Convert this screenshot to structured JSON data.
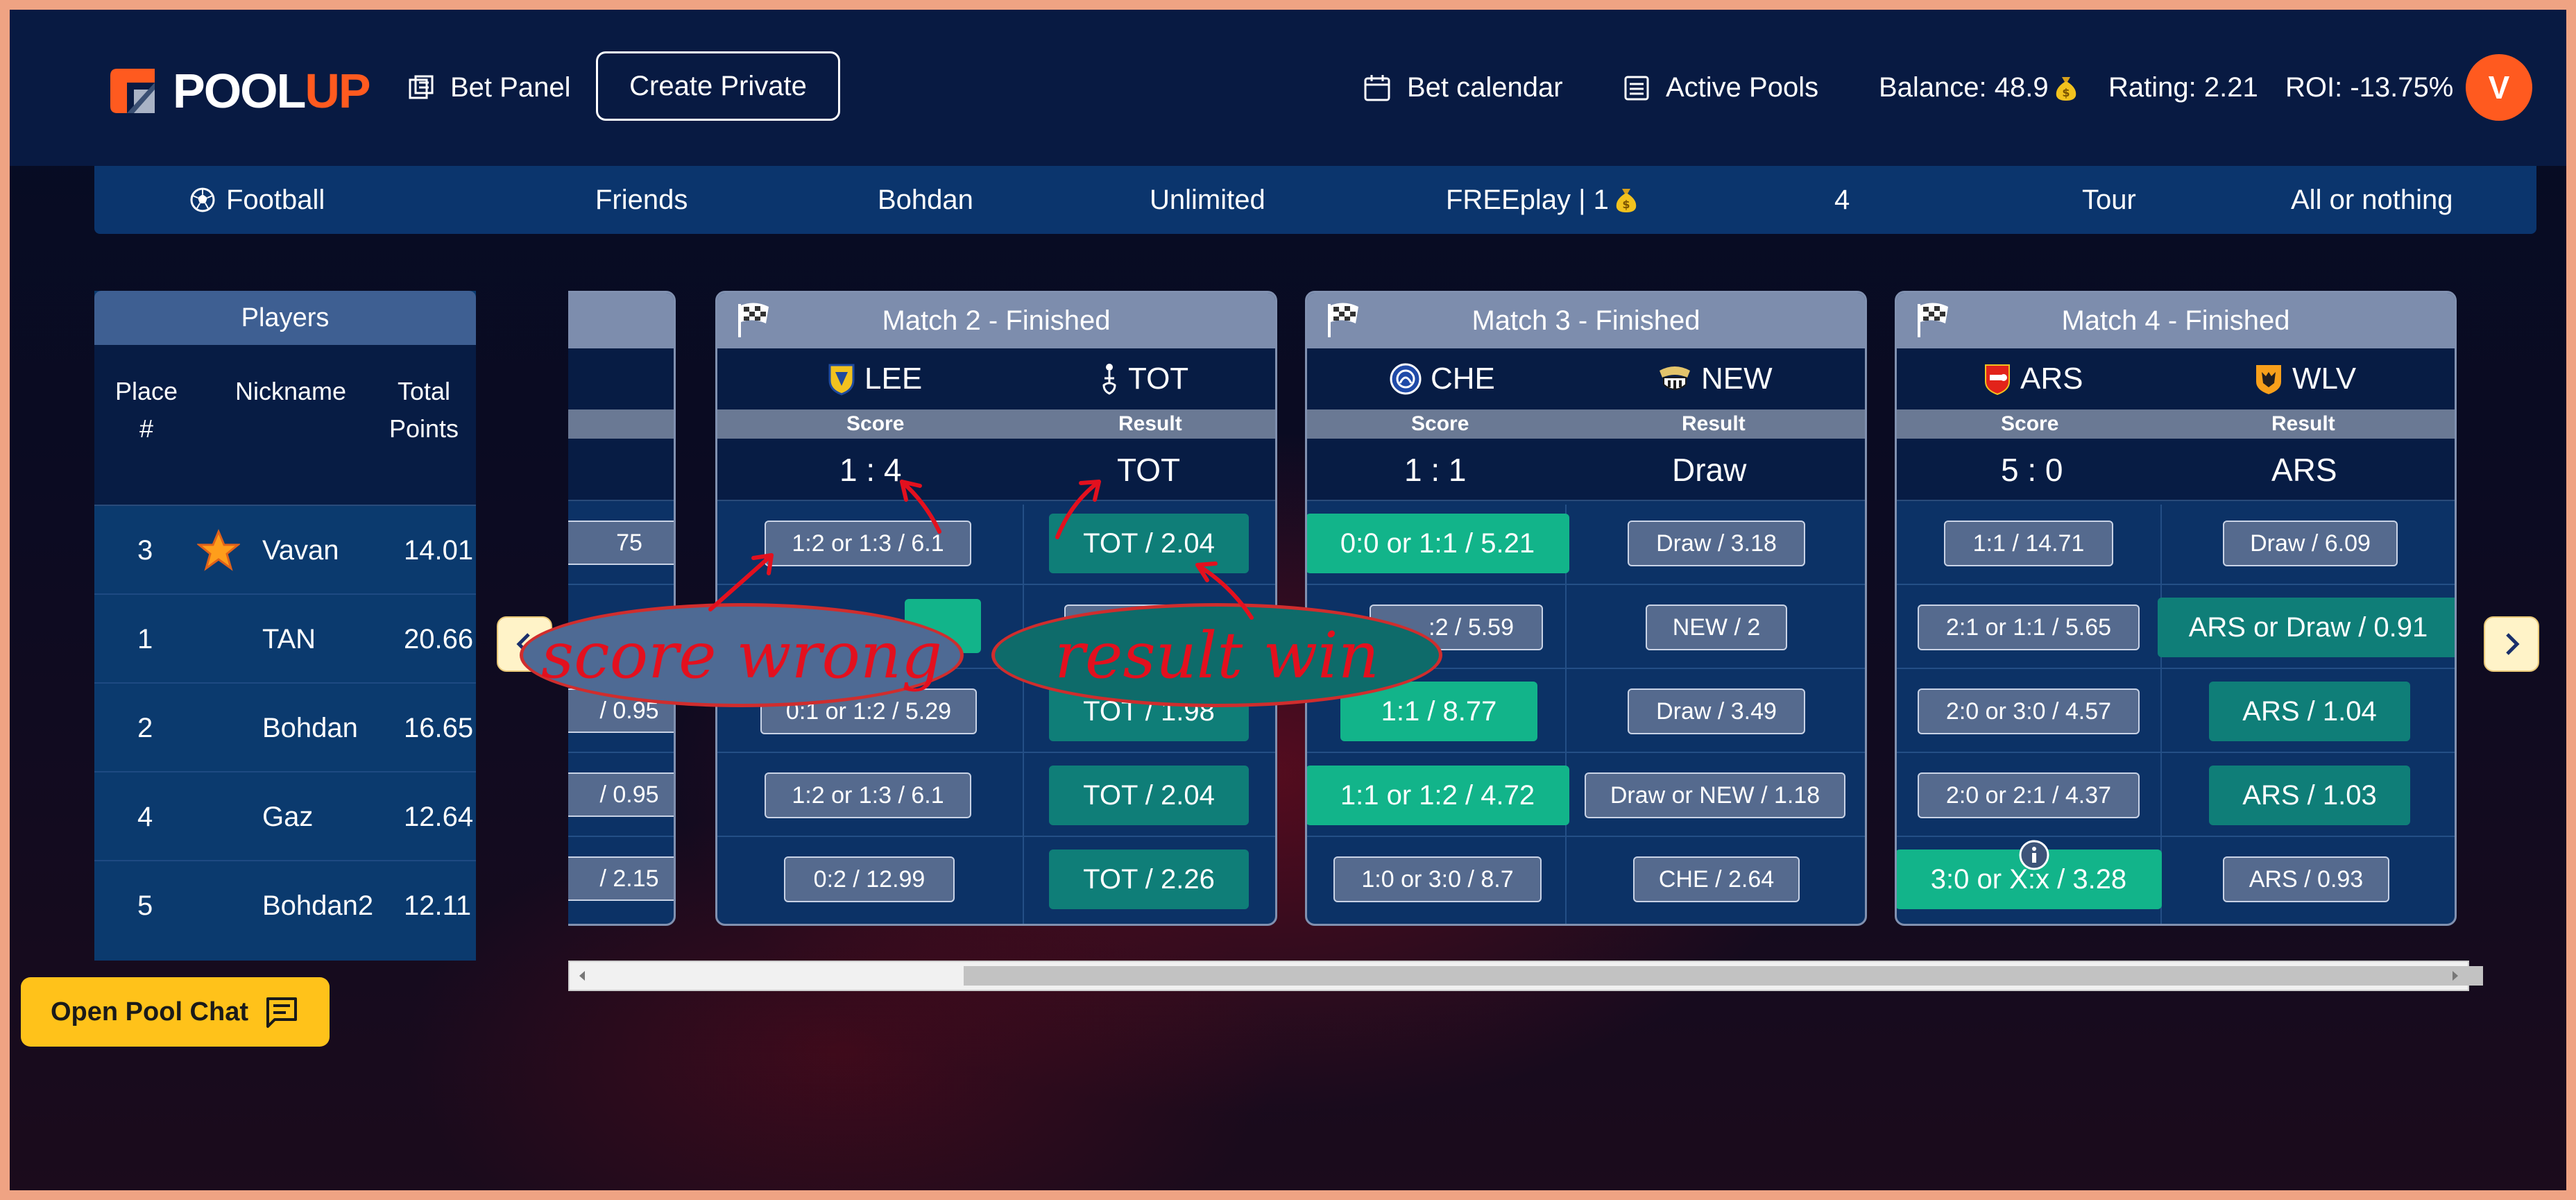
{
  "header": {
    "logo": {
      "part1": "POOL",
      "part2": "UP"
    },
    "nav": {
      "bet_panel": "Bet Panel",
      "create_private": "Create Private",
      "bet_calendar": "Bet calendar",
      "active_pools": "Active Pools"
    },
    "balance": "Balance: 48.9",
    "rating": "Rating: 2.21",
    "roi": "ROI: -13.75%",
    "avatar": "V"
  },
  "filters": [
    "Football",
    "Friends",
    "Bohdan",
    "Unlimited",
    "FREEplay | 1",
    "4",
    "Tour",
    "All or nothing"
  ],
  "players": {
    "title": "Players",
    "columns": {
      "place": "Place\n#",
      "nickname": "Nickname",
      "points": "Total\nPoints"
    },
    "rows": [
      {
        "place": "3",
        "nickname": "Vavan",
        "points": "14.01",
        "star": true
      },
      {
        "place": "1",
        "nickname": "TAN",
        "points": "20.66"
      },
      {
        "place": "2",
        "nickname": "Bohdan",
        "points": "16.65"
      },
      {
        "place": "4",
        "nickname": "Gaz",
        "points": "12.64"
      },
      {
        "place": "5",
        "nickname": "Bohdan2",
        "points": "12.11"
      }
    ]
  },
  "partial_card": {
    "values": [
      "75",
      "",
      "/ 0.95",
      "/ 0.95",
      "/ 2.15"
    ]
  },
  "matches": [
    {
      "title": "Match 2 - Finished",
      "home": "LEE",
      "away": "TOT",
      "score_label": "Score",
      "result_label": "Result",
      "score": "1 : 4",
      "result": "TOT",
      "score_bets": [
        {
          "label": "1:2 or 1:3 / 6.1",
          "style": "grey"
        },
        {
          "label": "",
          "style": "green"
        },
        {
          "label": "0:1 or 1:2 / 5.29",
          "style": "grey"
        },
        {
          "label": "1:2 or 1:3 / 6.1",
          "style": "grey"
        },
        {
          "label": "0:2 / 12.99",
          "style": "grey"
        }
      ],
      "result_bets": [
        {
          "label": "TOT / 2.04",
          "style": "teal"
        },
        {
          "label": "",
          "style": "grey"
        },
        {
          "label": "TOT / 1.98",
          "style": "teal"
        },
        {
          "label": "TOT / 2.04",
          "style": "teal"
        },
        {
          "label": "TOT / 2.26",
          "style": "teal"
        }
      ]
    },
    {
      "title": "Match 3 - Finished",
      "home": "CHE",
      "away": "NEW",
      "score_label": "Score",
      "result_label": "Result",
      "score": "1 : 1",
      "result": "Draw",
      "score_bets": [
        {
          "label": "0:0 or 1:1 / 5.21",
          "style": "green"
        },
        {
          "label": ":2 / 5.59",
          "style": "grey"
        },
        {
          "label": "1:1 / 8.77",
          "style": "green"
        },
        {
          "label": "1:1 or 1:2 / 4.72",
          "style": "green"
        },
        {
          "label": "1:0 or 3:0 / 8.7",
          "style": "grey"
        }
      ],
      "result_bets": [
        {
          "label": "Draw / 3.18",
          "style": "grey"
        },
        {
          "label": "NEW / 2",
          "style": "grey"
        },
        {
          "label": "Draw / 3.49",
          "style": "grey"
        },
        {
          "label": "Draw or NEW / 1.18",
          "style": "grey"
        },
        {
          "label": "CHE / 2.64",
          "style": "grey"
        }
      ]
    },
    {
      "title": "Match 4 - Finished",
      "home": "ARS",
      "away": "WLV",
      "score_label": "Score",
      "result_label": "Result",
      "score": "5 : 0",
      "result": "ARS",
      "score_bets": [
        {
          "label": "1:1 / 14.71",
          "style": "grey"
        },
        {
          "label": "2:1 or 1:1 / 5.65",
          "style": "grey"
        },
        {
          "label": "2:0 or 3:0 / 4.57",
          "style": "grey"
        },
        {
          "label": "2:0 or 2:1 / 4.37",
          "style": "grey"
        },
        {
          "label": "3:0 or X:x / 3.28",
          "style": "green"
        }
      ],
      "result_bets": [
        {
          "label": "Draw / 6.09",
          "style": "grey"
        },
        {
          "label": "ARS or Draw / 0.91",
          "style": "teal"
        },
        {
          "label": "ARS / 1.04",
          "style": "teal"
        },
        {
          "label": "ARS / 1.03",
          "style": "teal"
        },
        {
          "label": "ARS / 0.93",
          "style": "grey"
        }
      ]
    }
  ],
  "annotations": {
    "score_wrong": "score wrong",
    "result_win": "result win"
  },
  "chat": {
    "label": "Open Pool Chat"
  },
  "colors": {
    "accent": "#ff5a1f",
    "green": "#12b48a",
    "teal": "#0f7e78",
    "chat": "#ffc21a"
  }
}
